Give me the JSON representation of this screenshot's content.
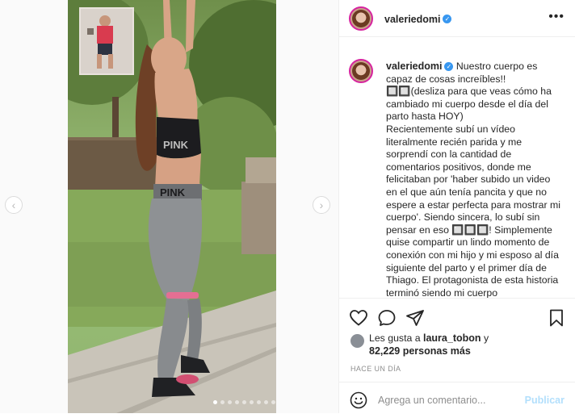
{
  "post": {
    "username": "valeriedomi",
    "caption": "Nuestro cuerpo es capaz de cosas increíbles!!\n🔲🔲(desliza para que veas cómo ha cambiado mi cuerpo desde el día del parto hasta HOY)\nRecientemente subí un vídeo literalmente recién parida y me sorprendí con la cantidad de comentarios positivos, donde me felicitaban por 'haber subido un video en el que aún tenía pancita y que no espere a estar perfecta para mostrar mi cuerpo'. Siendo sincera, lo subí sin pensar en eso 🔲🔲🔲! Simplemente quise compartir un lindo momento de conexión con mi hijo y mi esposo al día siguiente del parto y el primer día de Thiago. El protagonista de esta historia terminó siendo mi cuerpo",
    "likes_line1_prefix": "Les gusta a ",
    "likes_user": "laura_tobon",
    "likes_line1_suffix": " y",
    "likes_line2": "82,229 personas más",
    "timestamp": "HACE UN DÍA"
  },
  "media": {
    "top_brand": "PINK",
    "waist_brand": "PINK",
    "carousel_count": 9,
    "carousel_active": 0
  },
  "comment": {
    "placeholder": "Agrega un comentario...",
    "post_label": "Publicar"
  },
  "icons": {
    "prev": "chevron-left-icon",
    "next": "chevron-right-icon",
    "more": "more-horizontal-icon",
    "like": "heart-icon",
    "comment": "comment-icon",
    "share": "share-icon",
    "save": "bookmark-icon",
    "emoji": "emoji-icon"
  }
}
